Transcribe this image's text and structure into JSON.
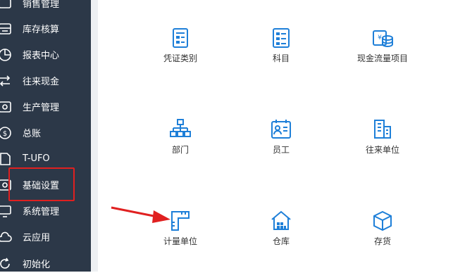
{
  "sidebar": {
    "items": [
      {
        "label": "销售管理",
        "icon": "sales-icon"
      },
      {
        "label": "库存核算",
        "icon": "inventory-icon"
      },
      {
        "label": "报表中心",
        "icon": "pie-chart-icon"
      },
      {
        "label": "往来现金",
        "icon": "transfer-icon"
      },
      {
        "label": "生产管理",
        "icon": "production-icon"
      },
      {
        "label": "总账",
        "icon": "ledger-icon"
      },
      {
        "label": "T-UFO",
        "icon": "document-icon"
      },
      {
        "label": "基础设置",
        "icon": "settings-icon",
        "highlighted": true
      },
      {
        "label": "系统管理",
        "icon": "monitor-icon"
      },
      {
        "label": "云应用",
        "icon": "cloud-icon"
      },
      {
        "label": "初始化",
        "icon": "refresh-icon"
      }
    ]
  },
  "tiles": [
    {
      "label": "凭证类别",
      "icon": "voucher-icon"
    },
    {
      "label": "科目",
      "icon": "subject-list-icon"
    },
    {
      "label": "现金流量项目",
      "icon": "cashflow-icon"
    },
    {
      "label": "部门",
      "icon": "org-chart-icon"
    },
    {
      "label": "员工",
      "icon": "employee-card-icon"
    },
    {
      "label": "往来单位",
      "icon": "building-icon"
    },
    {
      "label": "计量单位",
      "icon": "ruler-icon"
    },
    {
      "label": "仓库",
      "icon": "warehouse-icon"
    },
    {
      "label": "存货",
      "icon": "box-icon"
    }
  ],
  "colors": {
    "sidebar_bg": "#2c3848",
    "icon_blue": "#1e7fd8",
    "annotation_red": "#e02020"
  }
}
